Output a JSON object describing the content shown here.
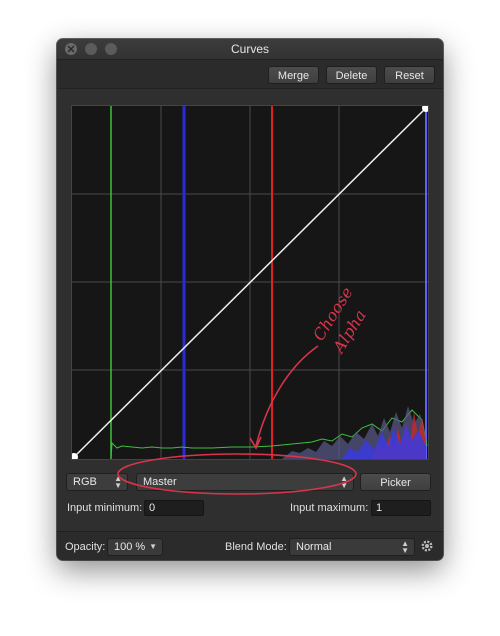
{
  "window": {
    "title": "Curves"
  },
  "toolbar": {
    "merge_label": "Merge",
    "delete_label": "Delete",
    "reset_label": "Reset"
  },
  "controls": {
    "channel_select": "RGB",
    "curve_select": "Master",
    "picker_label": "Picker",
    "input_minimum_label": "Input minimum:",
    "input_minimum_value": "0",
    "input_maximum_label": "Input maximum:",
    "input_maximum_value": "1"
  },
  "footer": {
    "opacity_label": "Opacity:",
    "opacity_value": "100 %",
    "blend_mode_label": "Blend Mode:",
    "blend_mode_value": "Normal"
  },
  "annotation": {
    "line1": "Choose",
    "line2": "Alpha"
  },
  "colors": {
    "annotation": "#d9344b",
    "histogram_green": "#3fbf3f",
    "histogram_blue": "#3030e0",
    "histogram_red": "#e02020",
    "window_bg": "#2f2f2f"
  },
  "icons": {
    "close": "close-icon",
    "gear": "gear-icon"
  }
}
